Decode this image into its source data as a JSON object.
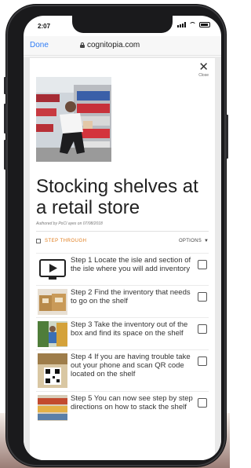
{
  "status_bar": {
    "time": "2:07"
  },
  "browser": {
    "done_label": "Done",
    "url": "cognitopia.com"
  },
  "card": {
    "close_label": "Close",
    "title": "Stocking shelves at a retail store",
    "subtitle": "Authored by PoCI ayes on 07/08/2018",
    "step_through_label": "STEP THROUGH",
    "options_label": "OPTIONS"
  },
  "steps": [
    {
      "text": "Step 1 Locate the isle and section of the isle where you will add inventory"
    },
    {
      "text": "Step 2 Find the inventory that needs to go on the shelf"
    },
    {
      "text": "Step 3 Take the inventory out of the box and find its space on the shelf"
    },
    {
      "text": "Step 4 If you are having trouble take out your phone and scan QR code located on the shelf"
    },
    {
      "text": "Step 5 You can now see step by step directions on how to stack the shelf"
    }
  ],
  "colors": {
    "accent_orange": "#e07b1a",
    "link_blue": "#2f7cf6",
    "phone_frame": "#1a1a1c"
  }
}
